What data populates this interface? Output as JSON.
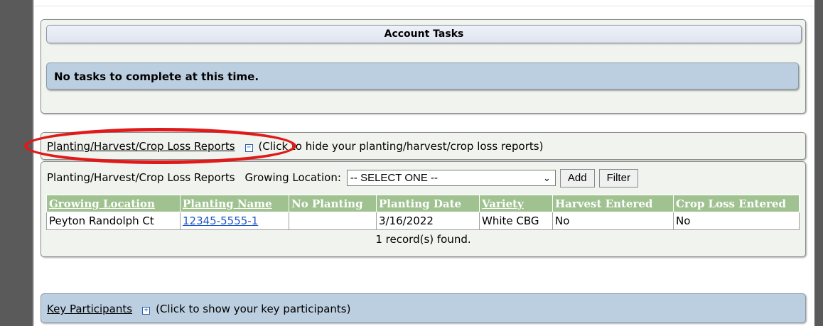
{
  "account_tasks": {
    "title": "Account Tasks",
    "message": "No tasks to complete at this time."
  },
  "phc_reports": {
    "toggle_link": "Planting/Harvest/Crop Loss Reports",
    "toggle_icon": "minus",
    "toggle_hint": "(Click to hide your planting/harvest/crop loss reports)",
    "label": "Planting/Harvest/Crop Loss Reports",
    "growing_location_label": "Growing Location:",
    "growing_location_value": "-- SELECT ONE --",
    "add_label": "Add",
    "filter_label": "Filter",
    "columns": [
      "Growing Location",
      "Planting Name",
      "No Planting",
      "Planting Date",
      "Variety",
      "Harvest Entered",
      "Crop Loss Entered"
    ],
    "rows": [
      {
        "growing_location": "Peyton Randolph Ct",
        "planting_name": "12345-5555-1",
        "no_planting": "",
        "planting_date": "3/16/2022",
        "variety": "White CBG",
        "harvest_entered": "No",
        "crop_loss_entered": "No"
      }
    ],
    "record_count": "1 record(s) found."
  },
  "key_participants": {
    "toggle_link": "Key Participants",
    "toggle_icon": "plus",
    "toggle_hint": "(Click to show your key participants)"
  },
  "colors": {
    "table_header": "#9fc290",
    "panel_blue": "#bccfe0",
    "highlight_ellipse": "#e01a1a"
  }
}
